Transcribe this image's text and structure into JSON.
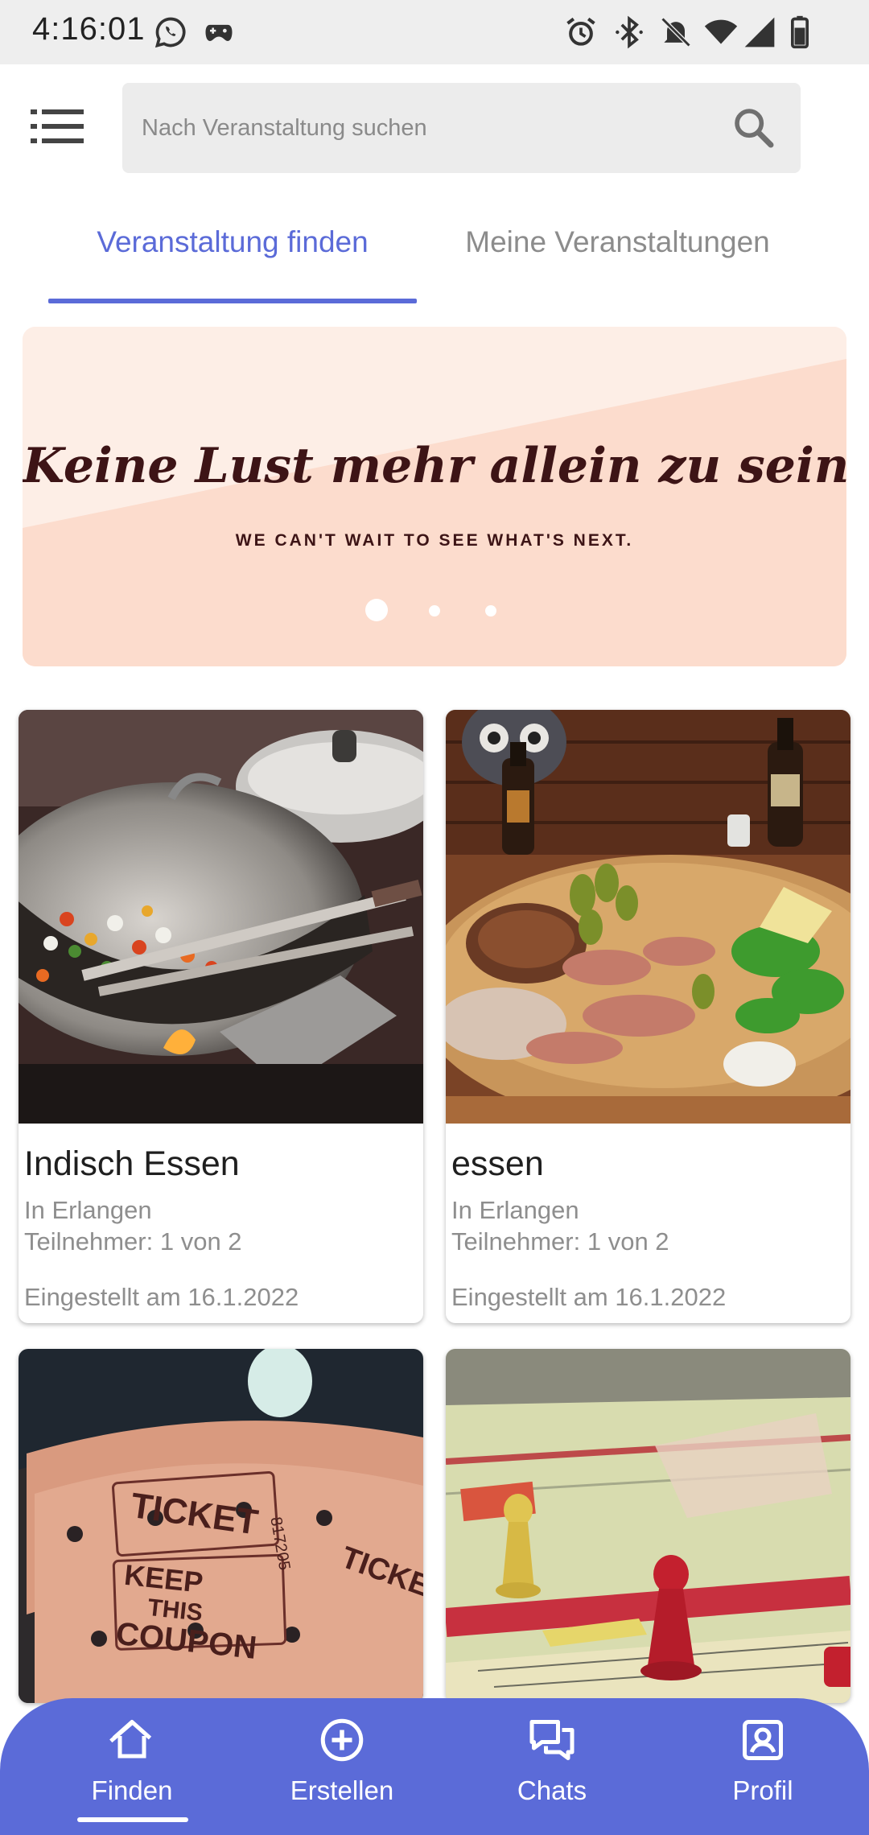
{
  "status_bar": {
    "time": "4:16:01",
    "left_icons": [
      "whatsapp-icon",
      "game-controller-icon"
    ],
    "right_icons": [
      "alarm-icon",
      "bluetooth-icon",
      "notifications-off-icon",
      "wifi-icon",
      "signal-icon",
      "battery-icon"
    ]
  },
  "header": {
    "search_placeholder": "Nach Veranstaltung suchen"
  },
  "tabs": [
    {
      "label": "Veranstaltung finden",
      "active": true
    },
    {
      "label": "Meine Veranstaltungen",
      "active": false
    }
  ],
  "banner": {
    "title": "Keine Lust mehr allein zu sein?",
    "subtitle": "WE CAN'T WAIT TO SEE WHAT'S NEXT.",
    "slide_count": 3,
    "active_slide": 1
  },
  "events": [
    {
      "title": "Indisch Essen",
      "location": "In Erlangen",
      "participants": "Teilnehmer: 1 von 2",
      "created": "Eingestellt am 16.1.2022",
      "image": "wok-cooking-photo"
    },
    {
      "title": "essen",
      "location": "In Erlangen",
      "participants": "Teilnehmer: 1 von 2",
      "created": "Eingestellt am 16.1.2022",
      "image": "meat-platter-photo"
    },
    {
      "title": "",
      "image": "tickets-photo",
      "ticket_text": [
        "TICKET",
        "KEEP",
        "THIS",
        "COUPON",
        "817205"
      ]
    },
    {
      "title": "",
      "image": "board-game-photo"
    }
  ],
  "bottom_nav": [
    {
      "label": "Finden",
      "icon": "home-icon",
      "active": true
    },
    {
      "label": "Erstellen",
      "icon": "add-circle-icon",
      "active": false
    },
    {
      "label": "Chats",
      "icon": "chat-bubbles-icon",
      "active": false
    },
    {
      "label": "Profil",
      "icon": "profile-icon",
      "active": false
    }
  ],
  "colors": {
    "accent": "#5b6bd8",
    "banner_bg": "#fde6da",
    "banner_text": "#3d1416"
  }
}
